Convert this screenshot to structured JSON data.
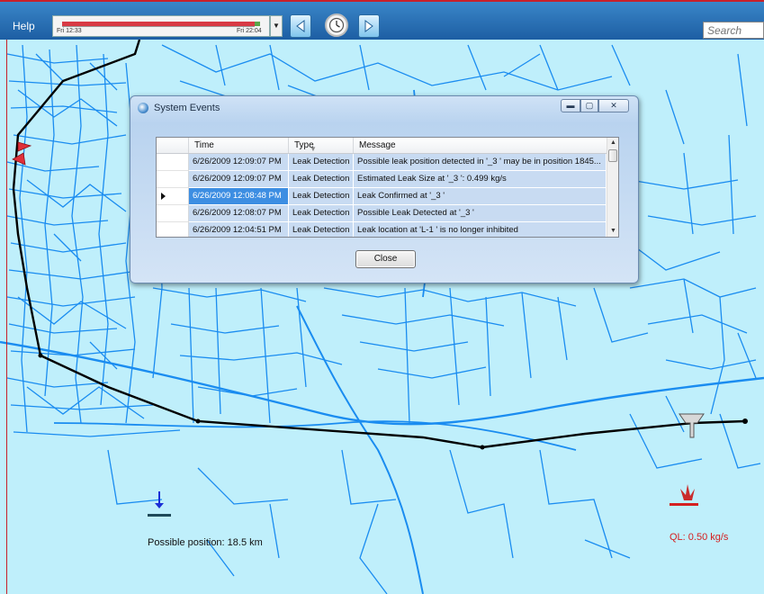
{
  "toolbar": {
    "help_label": "Help",
    "timeline_start": "Fri 12:33",
    "timeline_end": "Fri 22:04",
    "search_placeholder": "Search",
    "dropdown_glyph": "▼"
  },
  "dialog": {
    "title": "System Events",
    "columns": {
      "time": "Time",
      "type": "Type",
      "message": "Message"
    },
    "rows": [
      {
        "time": "6/26/2009 12:09:07 PM",
        "type": "Leak Detection",
        "message": "Possible leak position detected in '_3 ' may be in position 1845..."
      },
      {
        "time": "6/26/2009 12:09:07 PM",
        "type": "Leak Detection",
        "message": "Estimated Leak Size at '_3 ': 0.499 kg/s"
      },
      {
        "time": "6/26/2009 12:08:48 PM",
        "type": "Leak Detection",
        "message": "Leak Confirmed at '_3 '"
      },
      {
        "time": "6/26/2009 12:08:07 PM",
        "type": "Leak Detection",
        "message": "Possible Leak Detected at '_3 '"
      },
      {
        "time": "6/26/2009 12:04:51 PM",
        "type": "Leak Detection",
        "message": "Leak location at 'L-1 ' is no longer inhibited"
      }
    ],
    "selected_row": 2,
    "close_label": "Close"
  },
  "map": {
    "possible_position_text": "Possible position: 18.5 km",
    "ql_text": "QL: 0.50 kg/s",
    "road_color": "#1a8cf0",
    "pipeline_color": "#000000",
    "background_color": "#bfeffb"
  },
  "colors": {
    "toolbar_accent": "#c8202a",
    "selection": "#3d8ee2",
    "row_highlight": "#c8dbf2",
    "ql_color": "#d42020"
  }
}
